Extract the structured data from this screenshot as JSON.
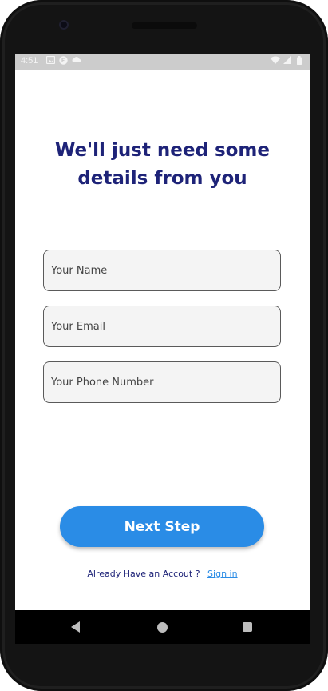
{
  "status_bar": {
    "time": "4:51",
    "left_icons": [
      "image-icon",
      "app-badge-icon",
      "cloud-icon"
    ],
    "right_icons": [
      "wifi-icon",
      "signal-icon",
      "battery-icon"
    ]
  },
  "heading": {
    "line1": "We'll just need some",
    "line2": "details from you"
  },
  "form": {
    "name_placeholder": "Your Name",
    "email_placeholder": "Your Email",
    "phone_placeholder": "Your Phone Number"
  },
  "actions": {
    "next_label": "Next Step",
    "signin_prompt": "Already Have an Accout ?",
    "signin_link": "Sign in"
  },
  "nav_bar": {
    "icons": [
      "back-icon",
      "home-icon",
      "recents-icon"
    ]
  },
  "colors": {
    "heading": "#1e2378",
    "accent": "#2a8ce6",
    "field_bg": "#f4f4f4",
    "status_bar_bg": "#cccccc"
  }
}
